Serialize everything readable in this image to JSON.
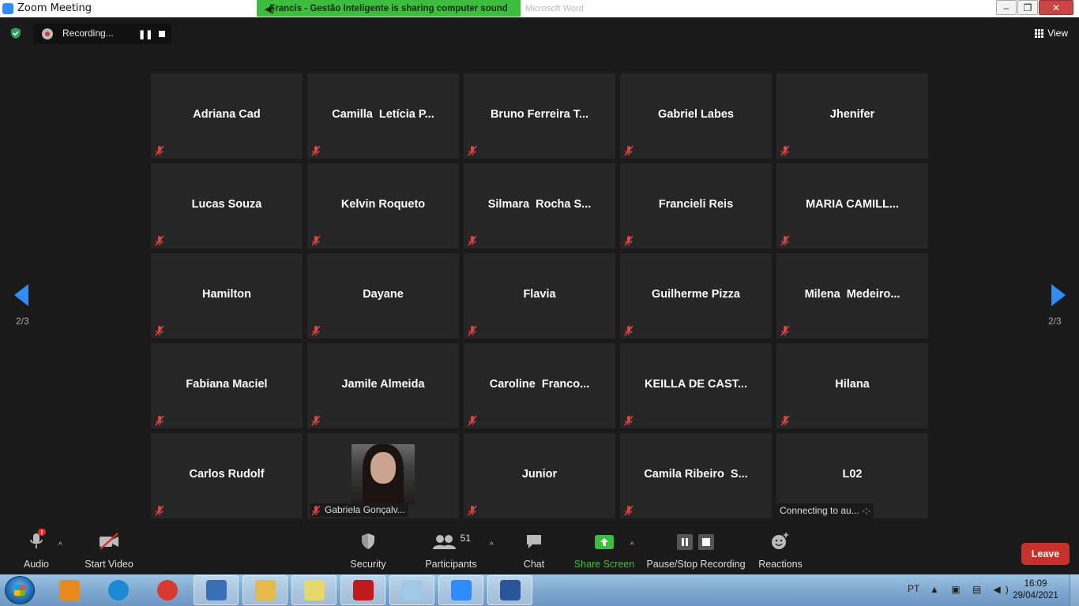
{
  "window": {
    "title": "Zoom Meeting",
    "ghost_title": "Microsoft Word"
  },
  "share_banner": {
    "text": "Francis - Gestão Inteligente is sharing computer sound"
  },
  "window_buttons": {
    "minimize": "–",
    "restore": "❐",
    "close": "✕"
  },
  "recording": {
    "label": "Recording...",
    "pause": "❚❚"
  },
  "view": {
    "label": "View"
  },
  "pager": {
    "left_label": "2/3",
    "right_label": "2/3"
  },
  "participants_tiles": [
    {
      "name": "Adriana Cad"
    },
    {
      "name": "Camilla  Letícia P..."
    },
    {
      "name": "Bruno Ferreira T..."
    },
    {
      "name": "Gabriel Labes"
    },
    {
      "name": "Jhenifer"
    },
    {
      "name": "Lucas Souza"
    },
    {
      "name": "Kelvin Roqueto"
    },
    {
      "name": "Silmara  Rocha S..."
    },
    {
      "name": "Francieli Reis"
    },
    {
      "name": "MARIA CAMILL..."
    },
    {
      "name": "Hamilton"
    },
    {
      "name": "Dayane"
    },
    {
      "name": "Flavia"
    },
    {
      "name": "Guilherme Pizza"
    },
    {
      "name": "Milena  Medeiro..."
    },
    {
      "name": "Fabiana Maciel"
    },
    {
      "name": "Jamile Almeida"
    },
    {
      "name": "Caroline  Franco..."
    },
    {
      "name": "KEILLA DE CAST..."
    },
    {
      "name": "Hilana"
    },
    {
      "name": "Carlos Rudolf"
    },
    {
      "name": "",
      "caption": "Gabriela Gonçalv..."
    },
    {
      "name": "Junior"
    },
    {
      "name": "Camila Ribeiro  S..."
    },
    {
      "name": "L02",
      "status": "Connecting to au... ·:·"
    }
  ],
  "toolbar": {
    "audio": "Audio",
    "audio_badge": "!",
    "start_video": "Start Video",
    "security": "Security",
    "participants": "Participants",
    "participants_count": "51",
    "chat": "Chat",
    "share_screen": "Share Screen",
    "pause_stop_recording": "Pause/Stop Recording",
    "reactions": "Reactions",
    "leave": "Leave",
    "caret": "^"
  },
  "taskbar": {
    "language": "PT",
    "tray_icons": "▲ ▣ ▤ ◀)",
    "time": "16:09",
    "date": "29/04/2021",
    "apps": [
      {
        "name": "media-player",
        "color": "#e98a1d"
      },
      {
        "name": "internet-explorer",
        "color": "#1b8ad6"
      },
      {
        "name": "chrome",
        "color": "#d9392d"
      },
      {
        "name": "remote-desktop",
        "color": "#3b6fb5"
      },
      {
        "name": "file-explorer",
        "color": "#e5b94a"
      },
      {
        "name": "sticky-notes",
        "color": "#e6d96b"
      },
      {
        "name": "acrobat-reader",
        "color": "#c0191b"
      },
      {
        "name": "notepad",
        "color": "#9fc9e6"
      },
      {
        "name": "zoom",
        "color": "#2d8cff"
      },
      {
        "name": "word",
        "color": "#2a5699"
      }
    ]
  },
  "colors": {
    "background": "#1a1a1a",
    "tile": "#262626",
    "share_green": "#3dbd3d",
    "leave_red": "#c9302c",
    "mute_red": "#e04343",
    "nav_blue": "#2d8cff"
  }
}
